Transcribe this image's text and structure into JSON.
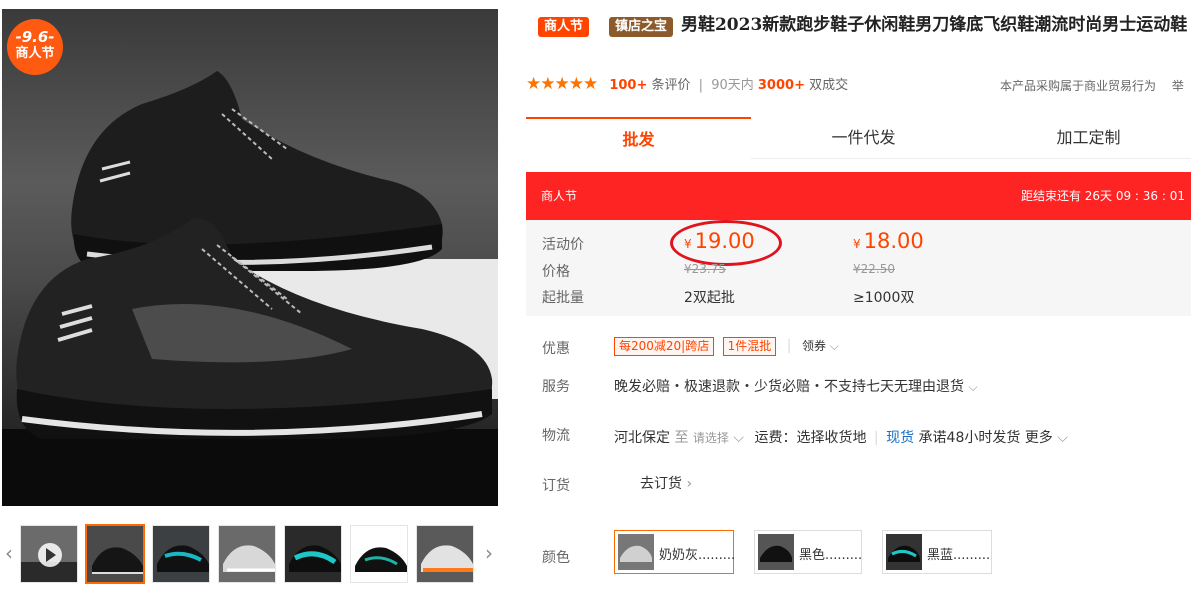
{
  "badge": {
    "line1": "-9.6-",
    "line2": "商人节"
  },
  "thumb_nav": {
    "prev": "‹",
    "next": "›"
  },
  "product": {
    "tag_festival": "商人节",
    "tag_store": "镇店之宝",
    "title": "男鞋2023新款跑步鞋子休闲鞋男刀锋底飞织鞋潮流时尚男士运动鞋",
    "stars": "★★★★★",
    "reviews_count": "100+",
    "reviews_label": "条评价",
    "period": "90天内",
    "sales_count": "3000+",
    "sales_label": "双成交",
    "trade_notice": "本产品采购属于商业贸易行为",
    "trade_notice_extra": "举"
  },
  "tabs": [
    "批发",
    "一件代发",
    "加工定制"
  ],
  "promo": {
    "label": "商人节",
    "countdown": "距结束还有 26天 09 : 36 : 01"
  },
  "pricing": {
    "currency": "¥",
    "activity_label": "活动价",
    "price_label": "价格",
    "moq_label": "起批量",
    "tiers": [
      {
        "activity_price": "19.00",
        "original_price": "23.75",
        "moq": "2双起批"
      },
      {
        "activity_price": "18.00",
        "original_price": "22.50",
        "moq": "≥1000双"
      }
    ]
  },
  "discount": {
    "label": "优惠",
    "coupon1": "每200减20|跨店",
    "coupon2": "1件混批",
    "more": "领券"
  },
  "service": {
    "label": "服务",
    "items": "晚发必赔・极速退款・少货必赔・不支持七天无理由退货"
  },
  "logistics": {
    "label": "物流",
    "origin": "河北保定",
    "to": "至",
    "dest": "请选择",
    "fee": "运费：选择收货地",
    "stock": "现货",
    "promise": "承诺48小时发货",
    "more": "更多"
  },
  "order": {
    "label": "订货",
    "link": "去订货"
  },
  "color": {
    "label": "颜色",
    "options": [
      "奶奶灰.........",
      "黑色.........",
      "黑蓝........."
    ]
  },
  "colors": {
    "accent": "#ff4400",
    "promo_bg": "#ff2424",
    "ring": "#e0141e",
    "badge_bg": "#ff5a12",
    "store_tag": "#8c5a2b"
  },
  "icons": {
    "star": "star-icon",
    "chevron_down": "chevron-down-icon",
    "chevron_right": "chevron-right-icon"
  }
}
